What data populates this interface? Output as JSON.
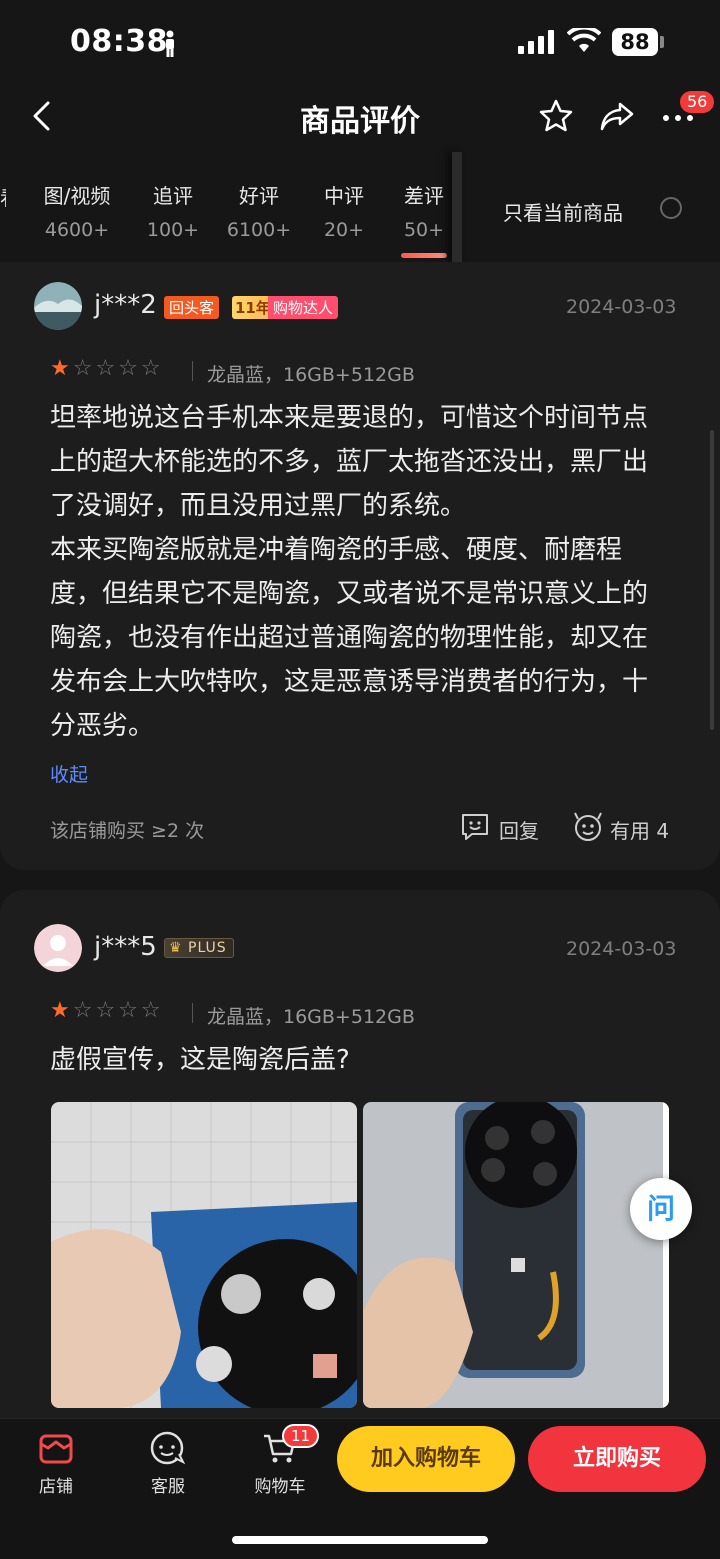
{
  "status_bar": {
    "time": "08:38",
    "battery": "88"
  },
  "nav": {
    "title": "商品评价",
    "cart_badge": "56"
  },
  "tabs": [
    {
      "label": "图/视频",
      "count": "4600+"
    },
    {
      "label": "追评",
      "count": "100+"
    },
    {
      "label": "好评",
      "count": "6100+"
    },
    {
      "label": "中评",
      "count": "20+"
    },
    {
      "label": "差评",
      "count": "50+"
    }
  ],
  "cut_tab_glyph": "看",
  "filter": {
    "only_current_label": "只看当前商品"
  },
  "reviews": [
    {
      "user": "j***2",
      "tags": {
        "returning": "回头客",
        "years": "11年",
        "shopper": "购物达人"
      },
      "date": "2024-03-03",
      "rating": 1,
      "variant": "龙晶蓝，16GB+512GB",
      "content": "坦率地说这台手机本来是要退的，可惜这个时间节点上的超大杯能选的不多，蓝厂太拖沓还没出，黑厂出了没调好，而且没用过黑厂的系统。\n本来买陶瓷版就是冲着陶瓷的手感、硬度、耐磨程度，但结果它不是陶瓷，又或者说不是常识意义上的陶瓷，也没有作出超过普通陶瓷的物理性能，却又在发布会上大吹特吹，这是恶意诱导消费者的行为，十分恶劣。",
      "collapse_label": "收起",
      "purchase_info": "该店铺购买 ≥2 次",
      "reply_label": "回复",
      "useful_label": "有用 4"
    },
    {
      "user": "j***5",
      "plus_label": "PLUS",
      "date": "2024-03-03",
      "rating": 1,
      "variant": "龙晶蓝，16GB+512GB",
      "content": "虚假宣传，这是陶瓷后盖?"
    }
  ],
  "float_button": {
    "label": "问"
  },
  "bottom_bar": {
    "shop_label": "店铺",
    "service_label": "客服",
    "cart_label": "购物车",
    "cart_count": "11",
    "add_to_cart": "加入购物车",
    "buy_now": "立即购买"
  },
  "colors": {
    "accent_red": "#f2343e",
    "accent_yellow": "#ffcb1f",
    "star_orange": "#ff6a2a",
    "link_blue": "#5b8cff"
  }
}
